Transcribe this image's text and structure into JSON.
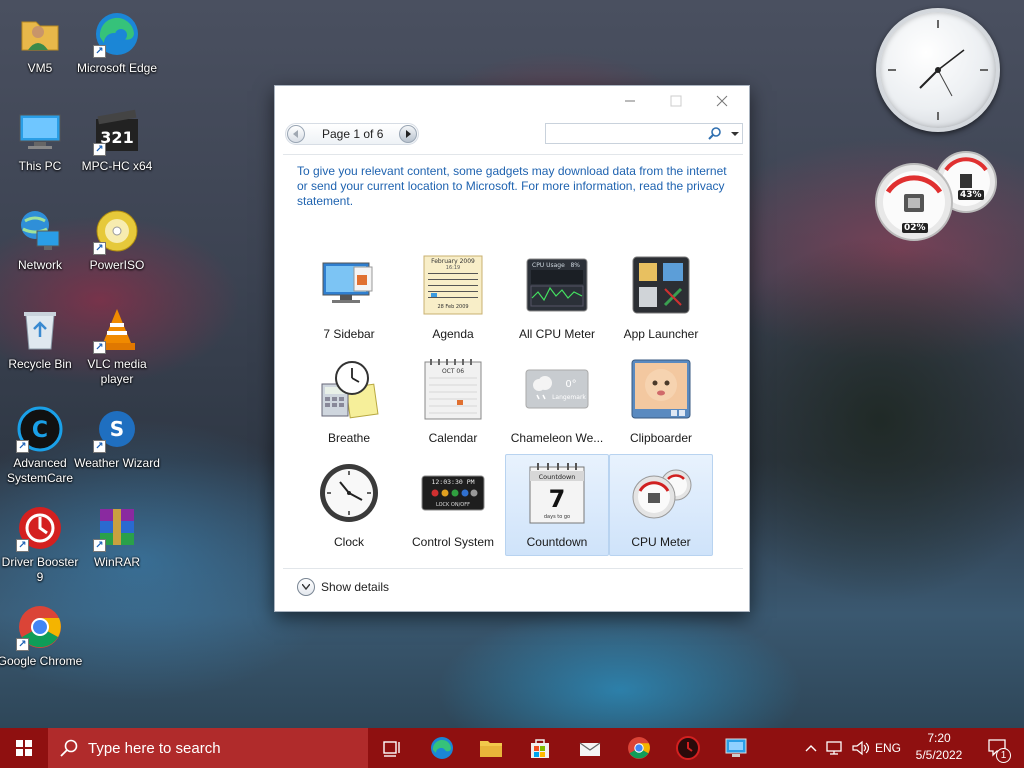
{
  "desktop": {
    "icons": [
      {
        "label": "VM5"
      },
      {
        "label": "Microsoft Edge"
      },
      {
        "label": "This PC"
      },
      {
        "label": "MPC-HC x64"
      },
      {
        "label": "Network"
      },
      {
        "label": "PowerISO"
      },
      {
        "label": "Recycle Bin"
      },
      {
        "label": "VLC media player"
      },
      {
        "label": "Advanced SystemCare"
      },
      {
        "label": "Weather Wizard"
      },
      {
        "label": "Driver Booster 9"
      },
      {
        "label": "WinRAR"
      },
      {
        "label": "Google Chrome"
      }
    ],
    "cpu_gadget": {
      "cpu_label": "02%",
      "ram_label": "43%"
    }
  },
  "gadget_window": {
    "pager_text": "Page 1 of 6",
    "search_value": "",
    "info_text": "To give you relevant content, some gadgets may download data from the internet or send your current location to Microsoft. For more information, read the privacy statement.",
    "gadgets": [
      {
        "name": "7 Sidebar"
      },
      {
        "name": "Agenda"
      },
      {
        "name": "All CPU Meter"
      },
      {
        "name": "App Launcher"
      },
      {
        "name": "Breathe"
      },
      {
        "name": "Calendar"
      },
      {
        "name": "Chameleon We..."
      },
      {
        "name": "Clipboarder"
      },
      {
        "name": "Clock"
      },
      {
        "name": "Control System"
      },
      {
        "name": "Countdown"
      },
      {
        "name": "CPU Meter"
      }
    ],
    "thumb_text": {
      "agenda_title": "February 2009",
      "agenda_date": "16:19",
      "agenda_footer": "28 Feb 2009",
      "cpu_title": "CPU Usage",
      "cpu_value": "8%",
      "calendar_month": "OCT 06",
      "chameleon_temp": "0°",
      "chameleon_place": "Langemark",
      "control_time": "12:03:30 PM",
      "control_lock": "LOCK ON/OFF",
      "countdown_header": "Countdown",
      "countdown_number": "7",
      "countdown_footer": "days to go"
    },
    "show_details": "Show details"
  },
  "taskbar": {
    "search_placeholder": "Type here to search",
    "language": "ENG",
    "time": "7:20",
    "date": "5/5/2022",
    "notification_count": "1"
  },
  "colors": {
    "taskbar": "#8f1010",
    "taskbar_search": "#b02b2b",
    "link_blue": "#1f63b0",
    "selection": "#cfe3fa"
  }
}
